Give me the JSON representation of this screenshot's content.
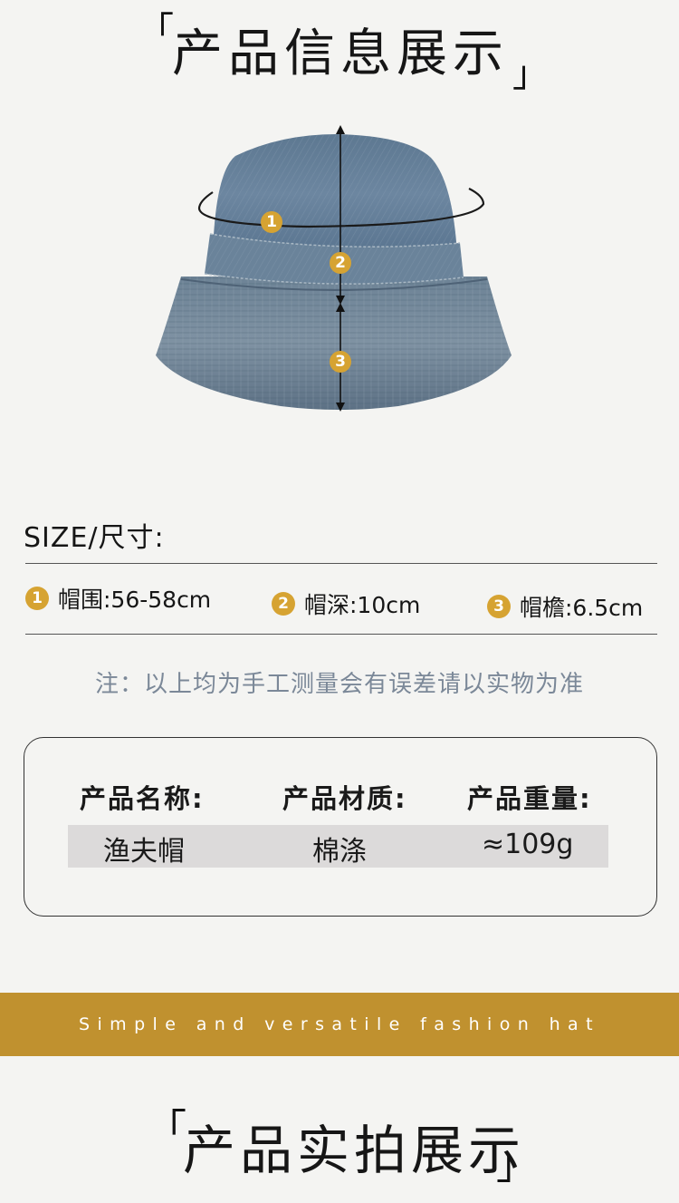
{
  "header": {
    "title": "产品信息展示",
    "open_bracket": "「",
    "close_bracket": "」"
  },
  "diagram": {
    "markers": [
      "1",
      "2",
      "3"
    ],
    "accent_color": "#d6a332"
  },
  "size": {
    "label": "SIZE/尺寸:",
    "items": [
      {
        "num": "1",
        "text": "帽围:56-58cm"
      },
      {
        "num": "2",
        "text": "帽深:10cm"
      },
      {
        "num": "3",
        "text": "帽檐:6.5cm"
      }
    ]
  },
  "note": "注：以上均为手工测量会有误差请以实物为准",
  "spec_card": {
    "headers": [
      "产品名称:",
      "产品材质:",
      "产品重量:"
    ],
    "values": [
      "渔夫帽",
      "棉涤",
      "≈109g"
    ]
  },
  "band": {
    "text": "Simple and versatile fashion hat",
    "color": "#c0912f"
  },
  "footer": {
    "title": "产品实拍展示",
    "open_bracket": "「",
    "close_bracket": "」"
  }
}
